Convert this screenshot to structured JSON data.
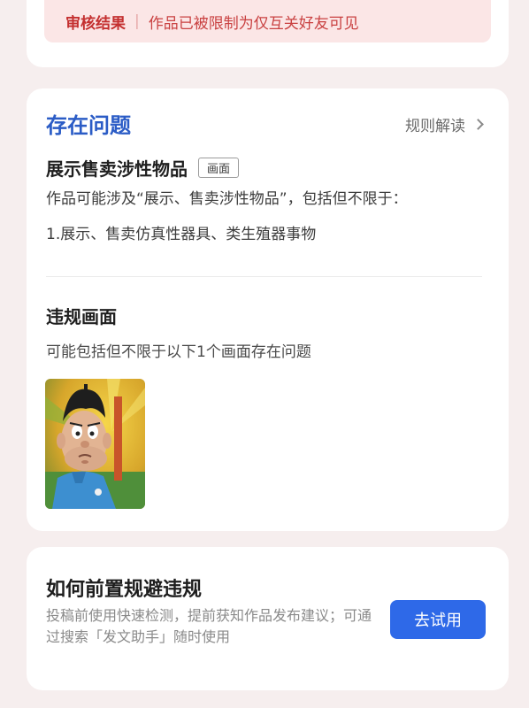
{
  "top_banner": {
    "status": "审核结果",
    "separator": "|",
    "message": "作品已被限制为仅互关好友可见"
  },
  "issues": {
    "title": "存在问题",
    "rules_link": "规则解读",
    "issue_name": "展示售卖涉性物品",
    "tag": "画面",
    "description": "作品可能涉及“展示、售卖涉性物品”，包括但不限于：",
    "item": "1.展示、售卖仿真性器具、类生殖器事物"
  },
  "violation": {
    "title": "违规画面",
    "subtitle": "可能包括但不限于以下1个画面存在问题"
  },
  "help": {
    "title": "如何前置规避违规",
    "text": "投稿前使用快速检测，提前获知作品发布建议；可通过搜索「发文助手」随时使用",
    "button": "去试用"
  },
  "colors": {
    "accent_blue": "#2b5cc6",
    "button_blue": "#2e69e8",
    "warning_red": "#d43a3a"
  }
}
